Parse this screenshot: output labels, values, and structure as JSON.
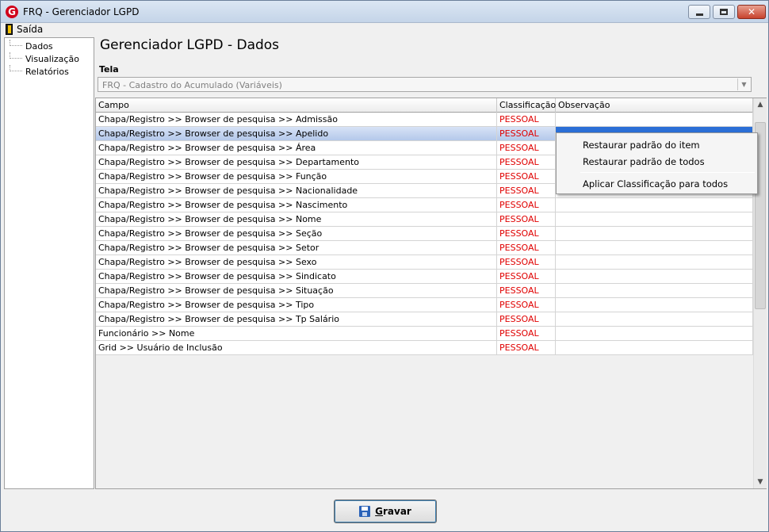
{
  "window": {
    "title": "FRQ - Gerenciador LGPD",
    "app_icon_letter": "G"
  },
  "menu": {
    "exit_label": "Saída"
  },
  "tree": {
    "items": [
      "Dados",
      "Visualização",
      "Relatórios"
    ]
  },
  "page": {
    "title": "Gerenciador LGPD - Dados"
  },
  "tela": {
    "label": "Tela",
    "value": "FRQ - Cadastro do Acumulado (Variáveis)"
  },
  "grid": {
    "columns": [
      "Campo",
      "Classificação",
      "Observação"
    ],
    "rows": [
      {
        "campo": "Chapa/Registro >> Browser de pesquisa >> Admissão",
        "classificacao": "PESSOAL",
        "observacao": ""
      },
      {
        "campo": "Chapa/Registro >> Browser de pesquisa >> Apelido",
        "classificacao": "PESSOAL",
        "observacao": ""
      },
      {
        "campo": "Chapa/Registro >> Browser de pesquisa >> Área",
        "classificacao": "PESSOAL",
        "observacao": ""
      },
      {
        "campo": "Chapa/Registro >> Browser de pesquisa >> Departamento",
        "classificacao": "PESSOAL",
        "observacao": ""
      },
      {
        "campo": "Chapa/Registro >> Browser de pesquisa >> Função",
        "classificacao": "PESSOAL",
        "observacao": ""
      },
      {
        "campo": "Chapa/Registro >> Browser de pesquisa >> Nacionalidade",
        "classificacao": "PESSOAL",
        "observacao": ""
      },
      {
        "campo": "Chapa/Registro >> Browser de pesquisa >> Nascimento",
        "classificacao": "PESSOAL",
        "observacao": ""
      },
      {
        "campo": "Chapa/Registro >> Browser de pesquisa >> Nome",
        "classificacao": "PESSOAL",
        "observacao": ""
      },
      {
        "campo": "Chapa/Registro >> Browser de pesquisa >> Seção",
        "classificacao": "PESSOAL",
        "observacao": ""
      },
      {
        "campo": "Chapa/Registro >> Browser de pesquisa >> Setor",
        "classificacao": "PESSOAL",
        "observacao": ""
      },
      {
        "campo": "Chapa/Registro >> Browser de pesquisa >> Sexo",
        "classificacao": "PESSOAL",
        "observacao": ""
      },
      {
        "campo": "Chapa/Registro >> Browser de pesquisa >> Sindicato",
        "classificacao": "PESSOAL",
        "observacao": ""
      },
      {
        "campo": "Chapa/Registro >> Browser de pesquisa >> Situação",
        "classificacao": "PESSOAL",
        "observacao": ""
      },
      {
        "campo": "Chapa/Registro >> Browser de pesquisa >> Tipo",
        "classificacao": "PESSOAL",
        "observacao": ""
      },
      {
        "campo": "Chapa/Registro >> Browser de pesquisa >> Tp Salário",
        "classificacao": "PESSOAL",
        "observacao": ""
      },
      {
        "campo": "Funcionário >> Nome",
        "classificacao": "PESSOAL",
        "observacao": ""
      },
      {
        "campo": "Grid >> Usuário de Inclusão",
        "classificacao": "PESSOAL",
        "observacao": ""
      }
    ],
    "selected_row_index": 1
  },
  "context_menu": {
    "items": [
      "Restaurar padrão do item",
      "Restaurar padrão de todos",
      "Aplicar Classificação para todos"
    ]
  },
  "buttons": {
    "save_label": "Gravar",
    "save_accelerator": "G"
  },
  "colors": {
    "classification_text": "#e00000",
    "selection": "#2b6fd6"
  }
}
